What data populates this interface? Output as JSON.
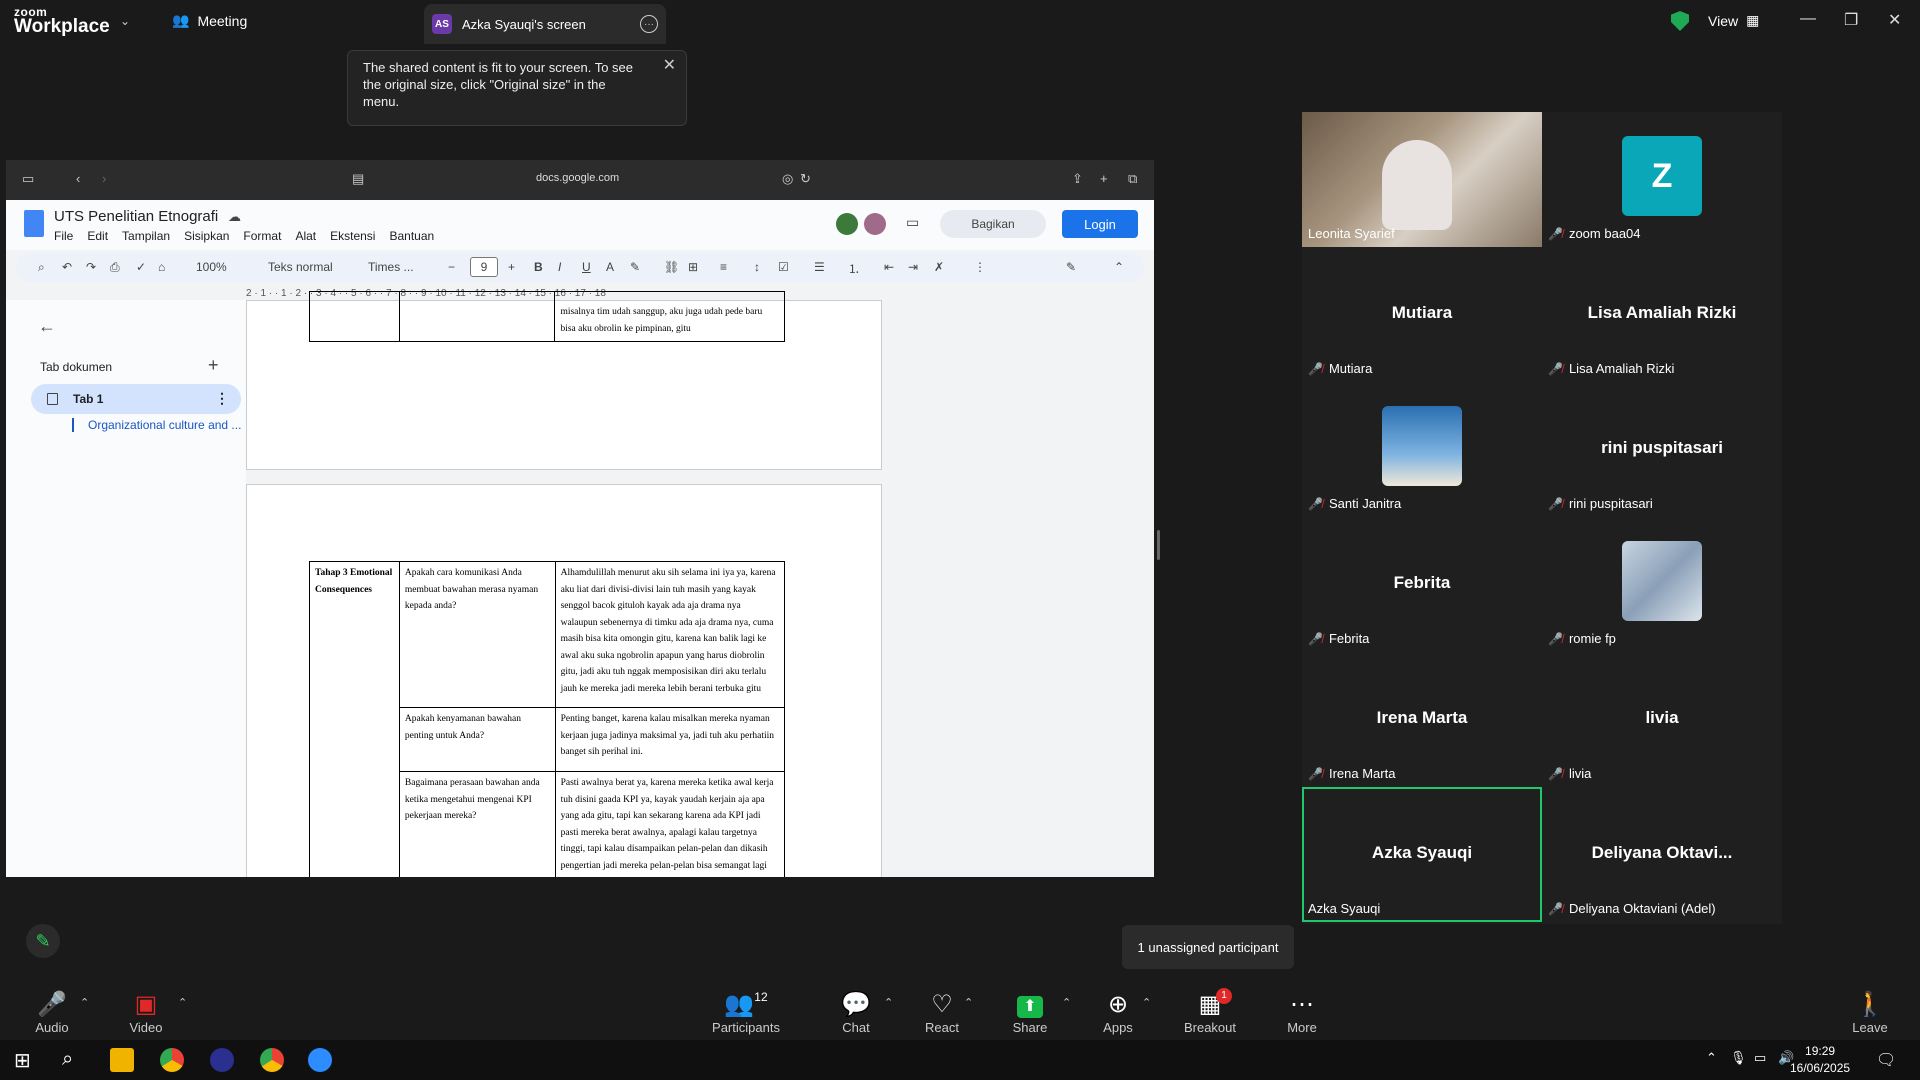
{
  "app": {
    "logo_small": "zoom",
    "logo_big": "Workplace",
    "meeting_label": "Meeting",
    "share_avatar": "AS",
    "share_title": "Azka Syauqi's screen",
    "view_label": "View"
  },
  "tooltip": {
    "text": "The shared content is fit to your screen. To see the original size, click \"Original size\" in the menu."
  },
  "browser": {
    "url": "docs.google.com"
  },
  "docs": {
    "title": "UTS Penelitian Etnografi",
    "menu": [
      "File",
      "Edit",
      "Tampilan",
      "Sisipkan",
      "Format",
      "Alat",
      "Ekstensi",
      "Bantuan"
    ],
    "share_label": "Bagikan",
    "login_label": "Login",
    "zoom": "100%",
    "style": "Teks normal",
    "font": "Times ...",
    "font_size": "9",
    "ruler": "2 · 1 · · 1 · 2 · · 3 · 4 · · 5 · 6 · · 7 · 8 · · 9 · 10 · 11 · 12 · 13 · 14 · 15 · 16 · 17 · 18"
  },
  "sidebar": {
    "section_title": "Tab dokumen",
    "tab_label": "Tab 1",
    "outline_item": "Organizational culture and ..."
  },
  "page1": {
    "cell_text": "misalnya tim udah sanggup, aku juga udah pede baru bisa aku obrolin ke pimpinan, gitu"
  },
  "page2": {
    "stage": "Tahap 3 Emotional Consequences",
    "rows": [
      {
        "q": "Apakah cara komunikasi Anda membuat bawahan merasa nyaman kepada anda?",
        "a": "Alhamdulillah menurut aku sih selama ini iya ya, karena aku liat dari divisi-divisi lain tuh masih yang kayak senggol bacok gituloh kayak ada aja drama nya walaupun sebenernya di timku ada aja drama nya, cuma masih bisa kita omongin gitu, karena kan balik lagi ke awal aku suka ngobrolin apapun yang harus diobrolin gitu, jadi aku tuh nggak memposisikan diri aku terlalu jauh ke mereka jadi mereka lebih berani terbuka gitu"
      },
      {
        "q": "Apakah kenyamanan bawahan penting untuk Anda?",
        "a": "Penting banget, karena kalau misalkan mereka nyaman kerjaan juga jadinya maksimal ya, jadi tuh aku perhatiin banget sih perihal ini."
      },
      {
        "q": "Bagaimana perasaan bawahan anda ketika mengetahui mengenai KPI pekerjaan mereka?",
        "a": "Pasti awalnya berat ya, karena mereka ketika awal kerja tuh disini gaada KPI ya, kayak yaudah kerjain aja apa yang ada gitu, tapi kan sekarang karena ada KPI jadi pasti mereka berat awalnya, apalagi kalau targetnya tinggi, tapi kalau disampaikan pelan-pelan dan dikasih pengertian jadi mereka pelan-pelan bisa semangat lagi"
      }
    ]
  },
  "participants_gallery": [
    {
      "display": "",
      "label": "Leonita Syarief",
      "muted": false,
      "type": "video"
    },
    {
      "display": "Z",
      "label": "zoom baa04",
      "muted": true,
      "type": "avatar"
    },
    {
      "display": "Mutiara",
      "label": "Mutiara",
      "muted": true,
      "type": "name"
    },
    {
      "display": "Lisa Amaliah Rizki",
      "label": "Lisa Amaliah Rizki",
      "muted": true,
      "type": "name"
    },
    {
      "display": "",
      "label": "Santi Janitra",
      "muted": true,
      "type": "photo"
    },
    {
      "display": "rini puspitasari",
      "label": "rini puspitasari",
      "muted": true,
      "type": "name"
    },
    {
      "display": "Febrita",
      "label": "Febrita",
      "muted": true,
      "type": "name"
    },
    {
      "display": "",
      "label": "romie fp",
      "muted": true,
      "type": "photo"
    },
    {
      "display": "Irena Marta",
      "label": "Irena Marta",
      "muted": true,
      "type": "name"
    },
    {
      "display": "livia",
      "label": "livia",
      "muted": true,
      "type": "name"
    },
    {
      "display": "Azka Syauqi",
      "label": "Azka Syauqi",
      "muted": false,
      "type": "name"
    },
    {
      "display": "Deliyana  Oktavi...",
      "label": "Deliyana Oktaviani (Adel)",
      "muted": true,
      "type": "name"
    }
  ],
  "unassigned": "1 unassigned participant",
  "toolbar": {
    "audio": "Audio",
    "video": "Video",
    "participants": "Participants",
    "participants_count": "12",
    "chat": "Chat",
    "react": "React",
    "share": "Share",
    "apps": "Apps",
    "breakout": "Breakout rooms",
    "breakout_badge": "1",
    "more": "More",
    "leave": "Leave room"
  },
  "clock": {
    "time": "19:29",
    "date": "16/06/2025"
  },
  "colors": {
    "accent_green": "#1fc86a",
    "share_green": "#17b84a",
    "docs_blue": "#1a73e8",
    "mute_red": "#e02828"
  }
}
